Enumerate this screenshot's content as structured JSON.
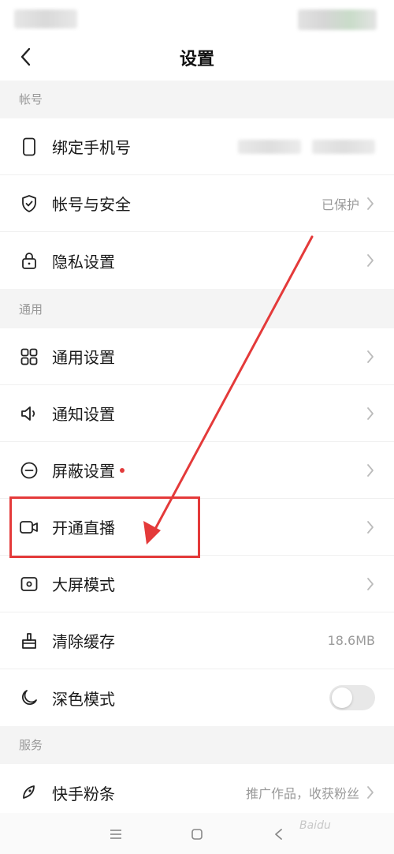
{
  "header": {
    "title": "设置"
  },
  "sections": {
    "account": "帐号",
    "general": "通用",
    "services": "服务"
  },
  "account_items": {
    "phone": {
      "label": "绑定手机号"
    },
    "security": {
      "label": "帐号与安全",
      "value": "已保护"
    },
    "privacy": {
      "label": "隐私设置"
    }
  },
  "general_items": {
    "general_settings": {
      "label": "通用设置"
    },
    "notification": {
      "label": "通知设置"
    },
    "block": {
      "label": "屏蔽设置"
    },
    "live": {
      "label": "开通直播"
    },
    "bigscreen": {
      "label": "大屏模式"
    },
    "cache": {
      "label": "清除缓存",
      "value": "18.6MB"
    },
    "darkmode": {
      "label": "深色模式",
      "enabled": false
    }
  },
  "service_items": {
    "fans": {
      "label": "快手粉条",
      "value": "推广作品，收获粉丝"
    }
  },
  "watermark": "Baidu",
  "colors": {
    "annotation_red": "#e43a3a",
    "dot_red": "#e23b3b"
  }
}
